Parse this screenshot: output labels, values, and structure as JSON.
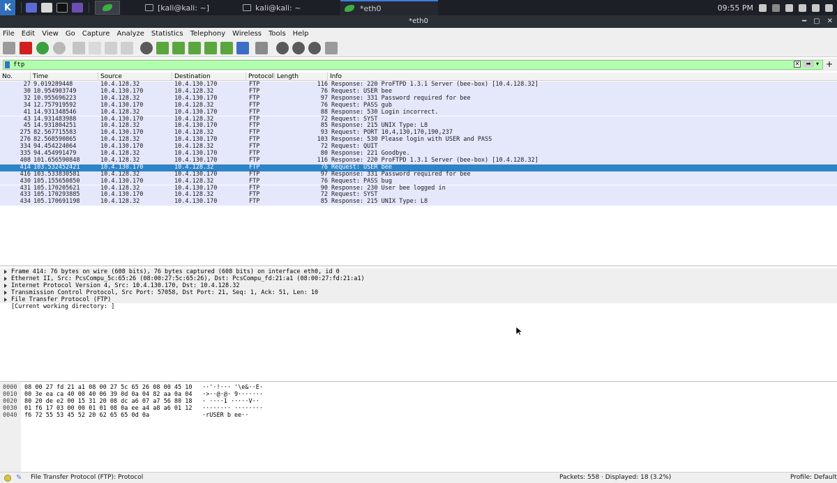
{
  "taskbar": {
    "tasks": [
      {
        "label": "[kali@kali: ~]"
      },
      {
        "label": "kali@kali: ~"
      },
      {
        "label": "*eth0"
      }
    ],
    "clock": "09:55 PM"
  },
  "window": {
    "title": "*eth0"
  },
  "menubar": {
    "items": [
      "File",
      "Edit",
      "View",
      "Go",
      "Capture",
      "Analyze",
      "Statistics",
      "Telephony",
      "Wireless",
      "Tools",
      "Help"
    ]
  },
  "filter": {
    "value": "ftp",
    "background": "#b3ffb0"
  },
  "packet_list": {
    "columns": [
      "No.",
      "Time",
      "Source",
      "Destination",
      "Protocol",
      "Length",
      "Info"
    ],
    "rows": [
      {
        "no": "27",
        "time": "9.019289448",
        "src": "10.4.128.32",
        "dst": "10.4.130.170",
        "proto": "FTP",
        "len": "116",
        "info": "Response: 220 ProFTPD 1.3.1 Server (bee-box) [10.4.128.32]"
      },
      {
        "no": "30",
        "time": "10.954903749",
        "src": "10.4.130.170",
        "dst": "10.4.128.32",
        "proto": "FTP",
        "len": "76",
        "info": "Request: USER bee"
      },
      {
        "no": "32",
        "time": "10.955696223",
        "src": "10.4.128.32",
        "dst": "10.4.130.170",
        "proto": "FTP",
        "len": "97",
        "info": "Response: 331 Password required for bee"
      },
      {
        "no": "34",
        "time": "12.757919592",
        "src": "10.4.130.170",
        "dst": "10.4.128.32",
        "proto": "FTP",
        "len": "76",
        "info": "Request: PASS gub"
      },
      {
        "no": "41",
        "time": "14.931348546",
        "src": "10.4.128.32",
        "dst": "10.4.130.170",
        "proto": "FTP",
        "len": "88",
        "info": "Response: 530 Login incorrect."
      },
      {
        "no": "43",
        "time": "14.931483988",
        "src": "10.4.130.170",
        "dst": "10.4.128.32",
        "proto": "FTP",
        "len": "72",
        "info": "Request: SYST"
      },
      {
        "no": "45",
        "time": "14.931804251",
        "src": "10.4.128.32",
        "dst": "10.4.130.170",
        "proto": "FTP",
        "len": "85",
        "info": "Response: 215 UNIX Type: L8"
      },
      {
        "no": "275",
        "time": "82.567715583",
        "src": "10.4.130.170",
        "dst": "10.4.128.32",
        "proto": "FTP",
        "len": "93",
        "info": "Request: PORT 10,4,130,170,190,237"
      },
      {
        "no": "276",
        "time": "82.568590865",
        "src": "10.4.128.32",
        "dst": "10.4.130.170",
        "proto": "FTP",
        "len": "103",
        "info": "Response: 530 Please login with USER and PASS"
      },
      {
        "no": "334",
        "time": "94.454224064",
        "src": "10.4.130.170",
        "dst": "10.4.128.32",
        "proto": "FTP",
        "len": "72",
        "info": "Request: QUIT"
      },
      {
        "no": "335",
        "time": "94.454991479",
        "src": "10.4.128.32",
        "dst": "10.4.130.170",
        "proto": "FTP",
        "len": "80",
        "info": "Response: 221 Goodbye."
      },
      {
        "no": "408",
        "time": "101.656590848",
        "src": "10.4.128.32",
        "dst": "10.4.130.170",
        "proto": "FTP",
        "len": "116",
        "info": "Response: 220 ProFTPD 1.3.1 Server (bee-box) [10.4.128.32]"
      },
      {
        "no": "414",
        "time": "103.532452421",
        "src": "10.4.130.170",
        "dst": "10.4.128.32",
        "proto": "FTP",
        "len": "76",
        "info": "Request: USER bee",
        "selected": true
      },
      {
        "no": "416",
        "time": "103.533830581",
        "src": "10.4.128.32",
        "dst": "10.4.130.170",
        "proto": "FTP",
        "len": "97",
        "info": "Response: 331 Password required for bee"
      },
      {
        "no": "430",
        "time": "105.155650850",
        "src": "10.4.130.170",
        "dst": "10.4.128.32",
        "proto": "FTP",
        "len": "76",
        "info": "Request: PASS bug"
      },
      {
        "no": "431",
        "time": "105.170205621",
        "src": "10.4.128.32",
        "dst": "10.4.130.170",
        "proto": "FTP",
        "len": "90",
        "info": "Response: 230 User bee logged in"
      },
      {
        "no": "433",
        "time": "105.170293885",
        "src": "10.4.130.170",
        "dst": "10.4.128.32",
        "proto": "FTP",
        "len": "72",
        "info": "Request: SYST"
      },
      {
        "no": "434",
        "time": "105.170691198",
        "src": "10.4.128.32",
        "dst": "10.4.130.170",
        "proto": "FTP",
        "len": "85",
        "info": "Response: 215 UNIX Type: L8"
      }
    ]
  },
  "details": {
    "rows": [
      "Frame 414: 76 bytes on wire (608 bits), 76 bytes captured (608 bits) on interface eth0, id 0",
      "Ethernet II, Src: PcsCompu_5c:65:26 (08:00:27:5c:65:26), Dst: PcsCompu_fd:21:a1 (08:00:27:fd:21:a1)",
      "Internet Protocol Version 4, Src: 10.4.130.170, Dst: 10.4.128.32",
      "Transmission Control Protocol, Src Port: 57058, Dst Port: 21, Seq: 1, Ack: 51, Len: 10",
      "File Transfer Protocol (FTP)"
    ],
    "extra": "[Current working directory: ]"
  },
  "hex": {
    "rows": [
      {
        "off": "0000",
        "bytes": "08 00 27 fd 21 a1 08 00  27 5c 65 26 08 00 45 10",
        "ascii": "··'·!···  '\\e&··E·"
      },
      {
        "off": "0010",
        "bytes": "00 3e ea ca 40 00 40 06  39 0d 0a 04 82 aa 0a 04",
        "ascii": "·>··@·@·  9·······"
      },
      {
        "off": "0020",
        "bytes": "80 20 de e2 00 15 31 20  08 dc a6 07 a7 56 80 18",
        "ascii": "· ····1   ·····V··"
      },
      {
        "off": "0030",
        "bytes": "01 f6 17 03 00 00 01 01  08 0a ee a4 a8 a6 01 12",
        "ascii": "········  ········"
      },
      {
        "off": "0040",
        "bytes": "f6 72 55 53 45 52 20 62  65 65 0d 0a",
        "ascii": "·rUSER b  ee··"
      }
    ]
  },
  "status": {
    "left": "File Transfer Protocol (FTP): Protocol",
    "middle": "Packets: 558 · Displayed: 18 (3.2%)",
    "right": "Profile: Default"
  }
}
